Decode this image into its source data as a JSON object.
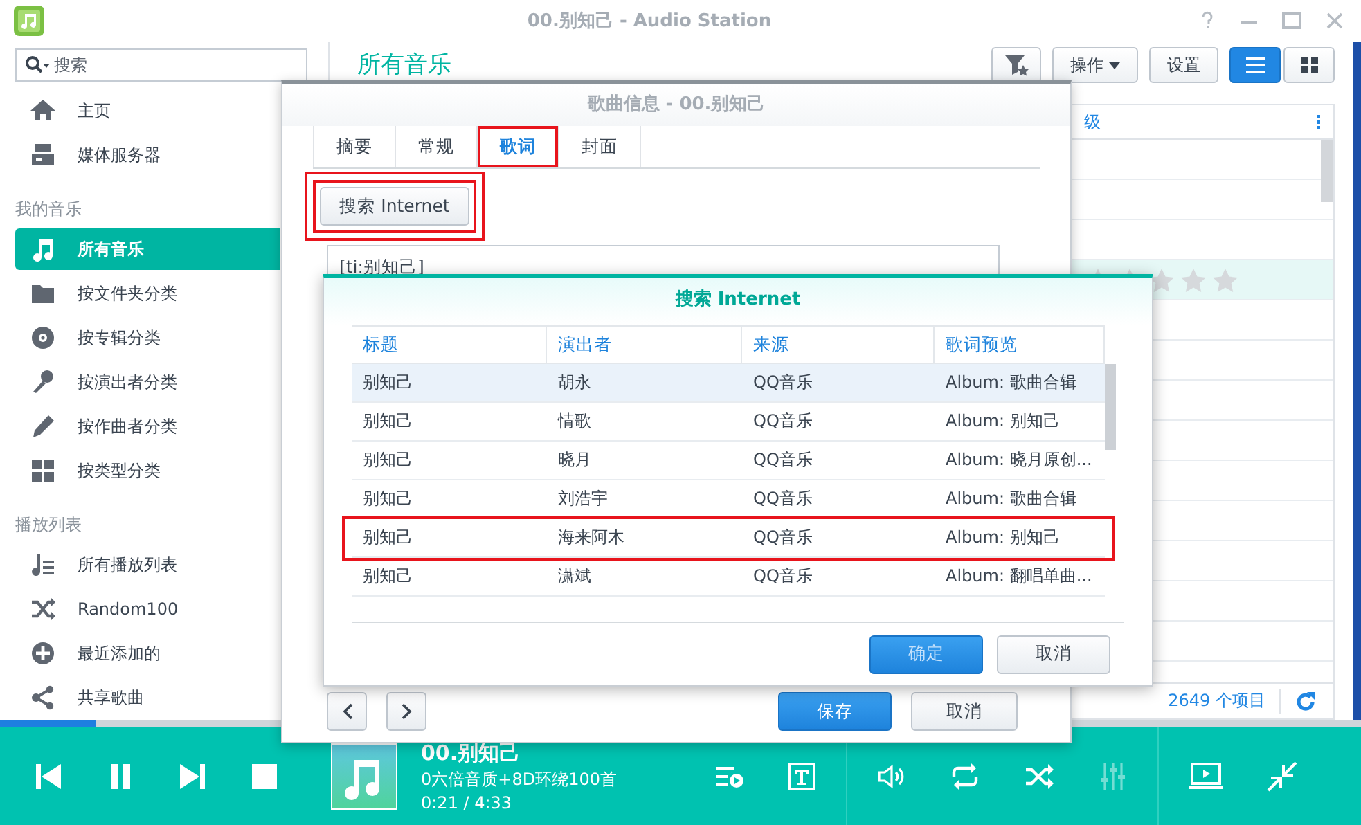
{
  "window": {
    "title": "00.别知己 - Audio Station"
  },
  "sidebar": {
    "search": {
      "placeholder": "搜索"
    },
    "sections": [
      {
        "items": [
          {
            "label": "主页",
            "kind": "home",
            "selected": false
          },
          {
            "label": "媒体服务器",
            "kind": "server",
            "selected": false
          }
        ]
      },
      {
        "heading": "我的音乐",
        "items": [
          {
            "label": "所有音乐",
            "kind": "note",
            "selected": true
          },
          {
            "label": "按文件夹分类",
            "kind": "folder",
            "selected": false
          },
          {
            "label": "按专辑分类",
            "kind": "disc",
            "selected": false
          },
          {
            "label": "按演出者分类",
            "kind": "mic",
            "selected": false
          },
          {
            "label": "按作曲者分类",
            "kind": "pencil",
            "selected": false
          },
          {
            "label": "按类型分类",
            "kind": "grid",
            "selected": false
          }
        ]
      },
      {
        "heading": "播放列表",
        "items": [
          {
            "label": "所有播放列表",
            "kind": "playlist",
            "selected": false
          },
          {
            "label": "Random100",
            "kind": "shuffle",
            "selected": false
          },
          {
            "label": "最近添加的",
            "kind": "plus",
            "selected": false
          },
          {
            "label": "共享歌曲",
            "kind": "share",
            "selected": false
          }
        ]
      }
    ]
  },
  "main": {
    "heading": "所有音乐",
    "toolbar": {
      "action": "操作",
      "settings": "设置",
      "views": [
        {
          "kind": "list",
          "selected": true
        },
        {
          "kind": "grid",
          "selected": false
        }
      ]
    },
    "table": {
      "header_text": "级",
      "rows": [
        {
          "selected": false
        },
        {
          "selected": false
        },
        {
          "selected": false
        },
        {
          "selected": true,
          "stars": 0
        },
        {
          "selected": false
        },
        {
          "selected": false
        },
        {
          "selected": false
        },
        {
          "selected": false
        },
        {
          "selected": false
        },
        {
          "selected": false
        },
        {
          "selected": false
        },
        {
          "selected": false
        },
        {
          "selected": false
        }
      ]
    },
    "footer": {
      "count": "2649 个项目"
    }
  },
  "info_dialog": {
    "title": "歌曲信息 - 00.别知己",
    "tabs": [
      {
        "label": "摘要",
        "selected": false,
        "highlighted": false
      },
      {
        "label": "常规",
        "selected": false,
        "highlighted": false
      },
      {
        "label": "歌词",
        "selected": true,
        "highlighted": true
      },
      {
        "label": "封面",
        "selected": false,
        "highlighted": false
      }
    ],
    "search_button": {
      "label": "搜索 Internet",
      "highlighted": true
    },
    "lyrics_text": "[ti:别知己]",
    "save": "保存",
    "cancel": "取消"
  },
  "search_dialog": {
    "title": "搜索 Internet",
    "columns": [
      "标题",
      "演出者",
      "来源",
      "歌词预览"
    ],
    "rows": [
      {
        "cells": [
          "别知己",
          "胡永",
          "QQ音乐",
          "Album: 歌曲合辑"
        ],
        "selected": true,
        "highlighted": false
      },
      {
        "cells": [
          "别知己",
          "情歌",
          "QQ音乐",
          "Album: 别知己"
        ],
        "selected": false,
        "highlighted": false
      },
      {
        "cells": [
          "别知己",
          "晓月",
          "QQ音乐",
          "Album: 晓月原创..."
        ],
        "selected": false,
        "highlighted": false
      },
      {
        "cells": [
          "别知己",
          "刘浩宇",
          "QQ音乐",
          "Album: 歌曲合辑"
        ],
        "selected": false,
        "highlighted": false
      },
      {
        "cells": [
          "别知己",
          "海来阿木",
          "QQ音乐",
          "Album: 别知己"
        ],
        "selected": false,
        "highlighted": true
      },
      {
        "cells": [
          "别知己",
          "潇斌",
          "QQ音乐",
          "Album: 翻唱单曲..."
        ],
        "selected": false,
        "highlighted": false
      }
    ],
    "ok": "确定",
    "cancel": "取消"
  },
  "player": {
    "progress": {
      "level": 0.07
    },
    "playing": true,
    "title": "00.别知己",
    "subtitle": "0六倍音质+8D环绕100首",
    "time": "0:21 / 4:33",
    "equalizer_enabled": false
  }
}
